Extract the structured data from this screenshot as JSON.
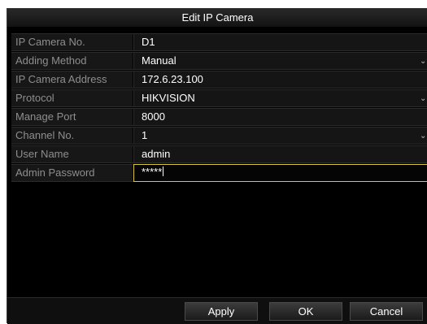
{
  "window": {
    "title": "Edit IP Camera"
  },
  "form": {
    "fields": [
      {
        "label": "IP Camera No.",
        "value": "D1",
        "type": "text"
      },
      {
        "label": "Adding Method",
        "value": "Manual",
        "type": "select"
      },
      {
        "label": "IP Camera Address",
        "value": "172.6.23.100",
        "type": "text"
      },
      {
        "label": "Protocol",
        "value": "HIKVISION",
        "type": "select"
      },
      {
        "label": "Manage Port",
        "value": "8000",
        "type": "text"
      },
      {
        "label": "Channel No.",
        "value": "1",
        "type": "select"
      },
      {
        "label": "User Name",
        "value": "admin",
        "type": "text"
      },
      {
        "label": "Admin Password",
        "value": "*****",
        "type": "password",
        "focused": true
      }
    ]
  },
  "buttons": {
    "apply": "Apply",
    "ok": "OK",
    "cancel": "Cancel"
  },
  "icons": {
    "dropdown": "chevron-down-icon"
  },
  "colors": {
    "focus_border": "#d7c93a",
    "background": "#000000",
    "label_text": "#8e8e8e",
    "value_text": "#ffffff"
  }
}
